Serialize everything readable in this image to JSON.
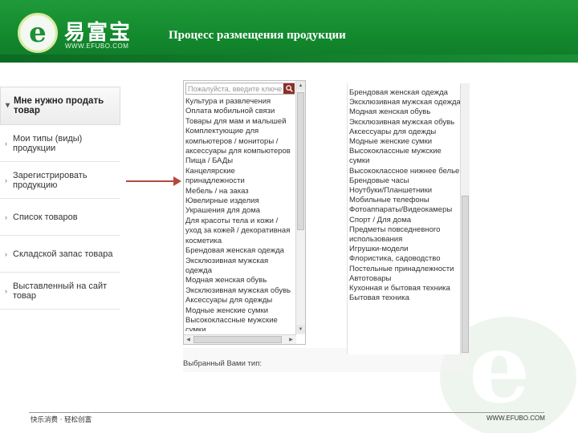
{
  "header": {
    "brand_cn": "易富宝",
    "brand_url": "WWW.EFUBO.COM",
    "title": "Процесс размещения продукции"
  },
  "sidebar": {
    "items": [
      {
        "label": "Мне нужно продать товар",
        "bullet": "▾",
        "active": true
      },
      {
        "label": "Мои типы (виды) продукции",
        "bullet": "›",
        "active": false
      },
      {
        "label": "Зарегистрировать продукцию",
        "bullet": "›",
        "active": false
      },
      {
        "label": "Список товаров",
        "bullet": "›",
        "active": false
      },
      {
        "label": "Складской запас товара",
        "bullet": "›",
        "active": false
      },
      {
        "label": "Выставленный на сайт товар",
        "bullet": "›",
        "active": false
      }
    ]
  },
  "category_panel": {
    "search_placeholder": "Пожалуйста, введите ключе",
    "items": [
      "Культура и развлечения",
      "Оплата мобильной связи",
      "Товары для мам и малышей",
      "Комплектующие для компьютеров / мониторы / аксессуары для компьютеров",
      "Пища / БАДы",
      "Канцелярские принадлежности",
      "Мебель / на заказ",
      "Ювелирные изделия",
      "Украшения для дома",
      "Для красоты тела и кожи / уход за кожей / декоративная косметика",
      "Брендовая женская одежда",
      "Эксклюзивная мужская одежда",
      "Модная женская обувь",
      "Эксклюзивная мужская обувь",
      "Аксессуары для одежды",
      "Модные женские сумки",
      "Высококлассные мужские сумки"
    ]
  },
  "subcategory_panel": {
    "items": [
      "Брендовая женская одежда",
      "Эксклюзивная мужская одежда",
      "Модная женская обувь",
      "Эксклюзивная мужская обувь",
      "Аксессуары для одежды",
      "Модные женские сумки",
      "Высококлассные мужские сумки",
      "Высококлассное нижнее белье",
      "Брендовые часы",
      "Ноутбуки/Планшетники",
      "Мобильные телефоны",
      "Фотоаппараты/Видеокамеры",
      "Спорт / Для дома",
      "Предметы повседневного использования",
      "Игрушки-модели",
      "Флористика, садоводство",
      "Постельные принадлежности",
      "Автотовары",
      "Кухонная и бытовая техника",
      "Бытовая техника"
    ]
  },
  "selected_type_label": "Выбранный Вами тип:",
  "footer": {
    "left": "快乐消费 · 轻松创富",
    "right": "WWW.EFUBO.COM"
  },
  "colors": {
    "header_green": "#138a2e",
    "arrow": "#b5483c",
    "search_button": "#8c2f2a"
  },
  "icons": {
    "search": "search-icon",
    "logo": "efubo-logo-icon"
  }
}
